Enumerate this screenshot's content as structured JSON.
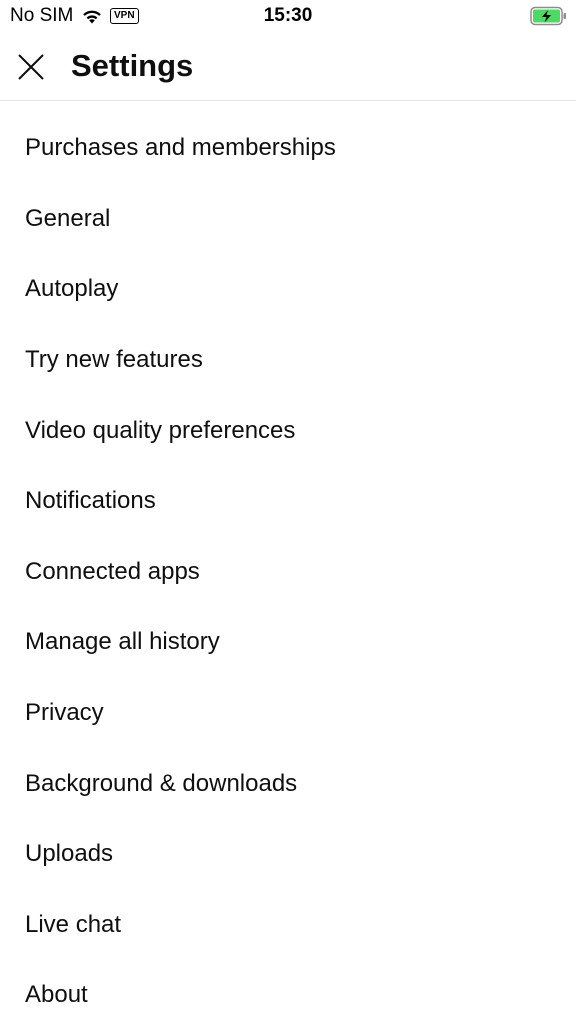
{
  "status_bar": {
    "carrier": "No SIM",
    "vpn_label": "VPN",
    "time": "15:30",
    "icons": [
      "wifi-icon",
      "vpn-badge",
      "battery-charging-icon"
    ]
  },
  "header": {
    "title": "Settings",
    "close_icon": "close-icon"
  },
  "settings": {
    "items": [
      {
        "label": "Purchases and memberships"
      },
      {
        "label": "General"
      },
      {
        "label": "Autoplay"
      },
      {
        "label": "Try new features"
      },
      {
        "label": "Video quality preferences"
      },
      {
        "label": "Notifications"
      },
      {
        "label": "Connected apps"
      },
      {
        "label": "Manage all history"
      },
      {
        "label": "Privacy"
      },
      {
        "label": "Background & downloads"
      },
      {
        "label": "Uploads"
      },
      {
        "label": "Live chat"
      },
      {
        "label": "About"
      }
    ]
  },
  "colors": {
    "text": "#0f0f0f",
    "divider": "#e5e5e5",
    "battery_charge": "#4cd964"
  }
}
